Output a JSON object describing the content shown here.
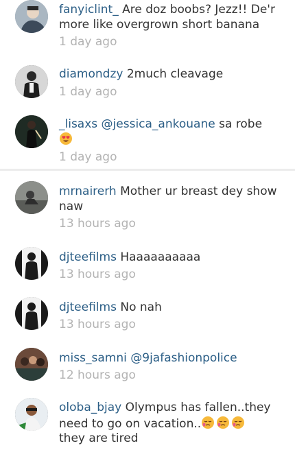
{
  "comments": [
    {
      "username": "fanyiclint_",
      "text": "Are doz boobs? Jezz!! De'r more like overgrown short banana",
      "time": "1 day ago",
      "avatar_icon": "user-avatar-photo"
    },
    {
      "username": "diamondzy",
      "text": "2much cleavage",
      "time": "1 day ago",
      "avatar_icon": "user-avatar-photo"
    },
    {
      "username": "_lisaxs",
      "mention": "@jessica_ankouane",
      "text": "sa robe",
      "emoji": "heart-eyes-emoji",
      "time": "1 day ago",
      "avatar_icon": "user-avatar-photo"
    },
    {
      "username": "mrnairerh",
      "text": "Mother ur breast dey show naw",
      "time": "13 hours ago",
      "avatar_icon": "user-avatar-photo"
    },
    {
      "username": "djteefilms",
      "text": "Haaaaaaaaaa",
      "time": "13 hours ago",
      "avatar_icon": "user-avatar-photo"
    },
    {
      "username": "djteefilms",
      "text": "No nah",
      "time": "13 hours ago",
      "avatar_icon": "user-avatar-photo"
    },
    {
      "username": "miss_samni",
      "mention": "@9jafashionpolice",
      "time": "12 hours ago",
      "avatar_icon": "user-avatar-photo"
    },
    {
      "username": "oloba_bjay",
      "text": "Olympus has fallen..they need to go on vacation..",
      "emoji": "sleepy-face-emoji",
      "emoji_count": 3,
      "text_after": "they are tired",
      "avatar_icon": "user-avatar-photo"
    }
  ],
  "colors": {
    "username": "#2b5e86",
    "body_text": "#333333",
    "timestamp": "#b3b3b3",
    "divider": "#ececec"
  }
}
